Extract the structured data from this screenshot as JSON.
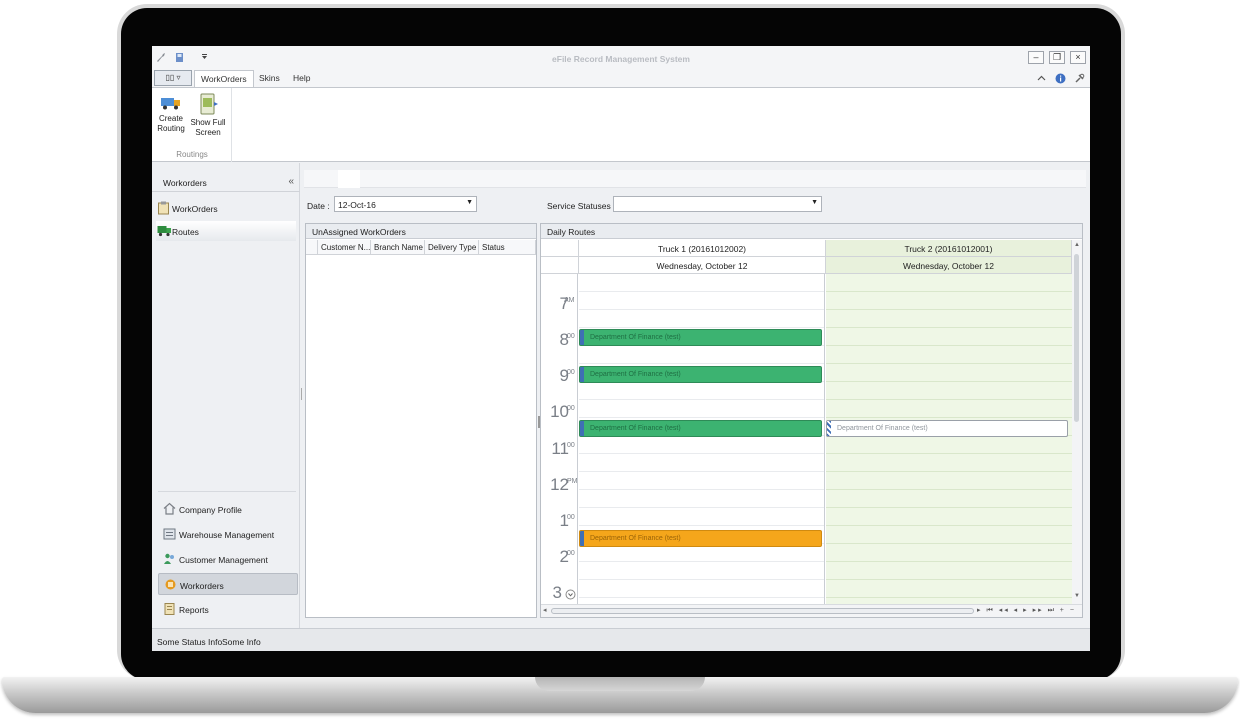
{
  "app": {
    "title": "eFile Record Management System"
  },
  "ribbon": {
    "tabs": [
      "WorkOrders",
      "Skins",
      "Help"
    ],
    "buttons": [
      {
        "label_line1": "Create",
        "label_line2": "Routing"
      },
      {
        "label_line1": "Show Full",
        "label_line2": "Screen"
      }
    ],
    "group_label": "Routings"
  },
  "nav": {
    "header": "Workorders",
    "collapse_glyph": "«",
    "items": [
      "WorkOrders",
      "Routes"
    ],
    "groups": [
      "Company Profile",
      "Warehouse Management",
      "Customer Management",
      "Workorders",
      "Reports"
    ]
  },
  "filters": {
    "date_label": "Date :",
    "date_value": "12-Oct-16",
    "service_label": "Service Statuses :",
    "service_value": ""
  },
  "unassigned": {
    "title": "UnAssigned WorkOrders",
    "columns": [
      "Customer N...",
      "Branch Name",
      "Delivery Type",
      "Status"
    ]
  },
  "routes": {
    "title": "Daily Routes",
    "resources": [
      "Truck 1 (20161012002)",
      "Truck 2 (20161012001)"
    ],
    "date_header": "Wednesday, October 12",
    "hours": [
      {
        "h": "7",
        "m": "AM"
      },
      {
        "h": "8",
        "m": "00"
      },
      {
        "h": "9",
        "m": "00"
      },
      {
        "h": "10",
        "m": "00"
      },
      {
        "h": "11",
        "m": "00"
      },
      {
        "h": "12",
        "m": "PM"
      },
      {
        "h": "1",
        "m": "00"
      },
      {
        "h": "2",
        "m": "00"
      },
      {
        "h": "3",
        "m": ""
      }
    ],
    "appointments": [
      {
        "text": "Department Of Finance (test)",
        "resource": 1,
        "color": "#3cb371"
      },
      {
        "text": "Department Of Finance (test)",
        "resource": 1,
        "color": "#3cb371"
      },
      {
        "text": "Department Of Finance (test)",
        "resource": 1,
        "color": "#3cb371"
      },
      {
        "text": "Department Of Finance (test)",
        "resource": 2,
        "color": "#ffffff"
      },
      {
        "text": "Department Of Finance (test)",
        "resource": 1,
        "color": "#f5a61b"
      }
    ]
  },
  "statusbar": {
    "left": "Some Status Info",
    "right": "Some Info"
  }
}
